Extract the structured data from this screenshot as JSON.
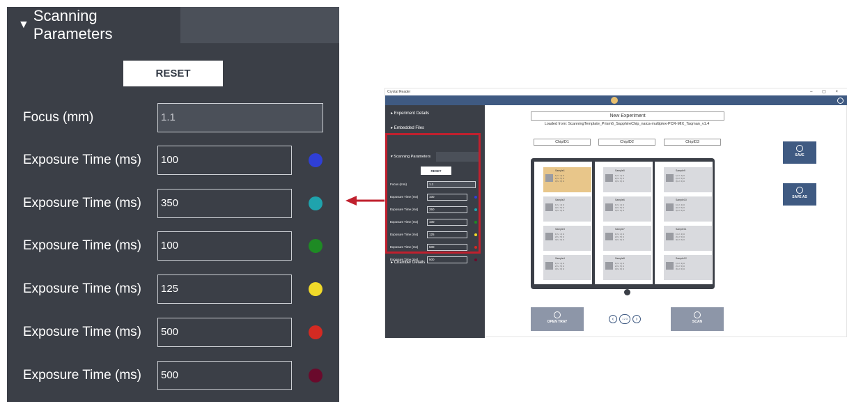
{
  "zoom": {
    "tab_label": "Scanning Parameters",
    "reset_label": "RESET",
    "focus": {
      "label": "Focus (mm)",
      "value": "1.1"
    },
    "exposures": [
      {
        "label": "Exposure Time (ms)",
        "value": "100",
        "color": "#2f3fd6"
      },
      {
        "label": "Exposure Time (ms)",
        "value": "350",
        "color": "#1fa3ad"
      },
      {
        "label": "Exposure Time (ms)",
        "value": "100",
        "color": "#1e8a24"
      },
      {
        "label": "Exposure Time (ms)",
        "value": "125",
        "color": "#f1da2a"
      },
      {
        "label": "Exposure Time (ms)",
        "value": "500",
        "color": "#d42a22"
      },
      {
        "label": "Exposure Time (ms)",
        "value": "500",
        "color": "#6a0a2c"
      }
    ]
  },
  "window": {
    "title": "Crystal Reader",
    "controls": "–  ▢  ×",
    "sidebar": {
      "experiment_details": "Experiment Details",
      "embedded_files": "Embedded Files",
      "scanning_parameters": "Scanning Parameters",
      "chamber_details": "Chamber Details"
    },
    "scan": {
      "reset_label": "RESET",
      "focus_label": "Focus (mm)",
      "focus_value": "1.1",
      "exposures": [
        {
          "label": "Exposure Time (ms)",
          "value": "100"
        },
        {
          "label": "Exposure Time (ms)",
          "value": "350"
        },
        {
          "label": "Exposure Time (ms)",
          "value": "100"
        },
        {
          "label": "Exposure Time (ms)",
          "value": "125"
        },
        {
          "label": "Exposure Time (ms)",
          "value": "500"
        },
        {
          "label": "Exposure Time (ms)",
          "value": "500"
        }
      ]
    },
    "experiment_name": "New Experiment",
    "loaded_from": "Loaded from: ScanningTemplate_Prism6_SapphireChip_naica-multiplex-PCR-MIX_Taqman_v1.4",
    "chips": [
      "ChipID1",
      "ChipID2",
      "ChipID3"
    ],
    "samples": [
      [
        "Sample1",
        "Sample2",
        "Sample3",
        "Sample4"
      ],
      [
        "Sample5",
        "Sample6",
        "Sample7",
        "Sample8"
      ],
      [
        "Sample9",
        "Sample10",
        "Sample11",
        "Sample12"
      ]
    ],
    "sample_detail": "1) U  4) U\n2) U  5) U\n3) U  6) U",
    "save_label": "SAVE",
    "save_as_label": "SAVE AS",
    "open_tray_label": "OPEN TRAY",
    "scan_label": "SCAN",
    "pager_label": "1 2 3"
  }
}
